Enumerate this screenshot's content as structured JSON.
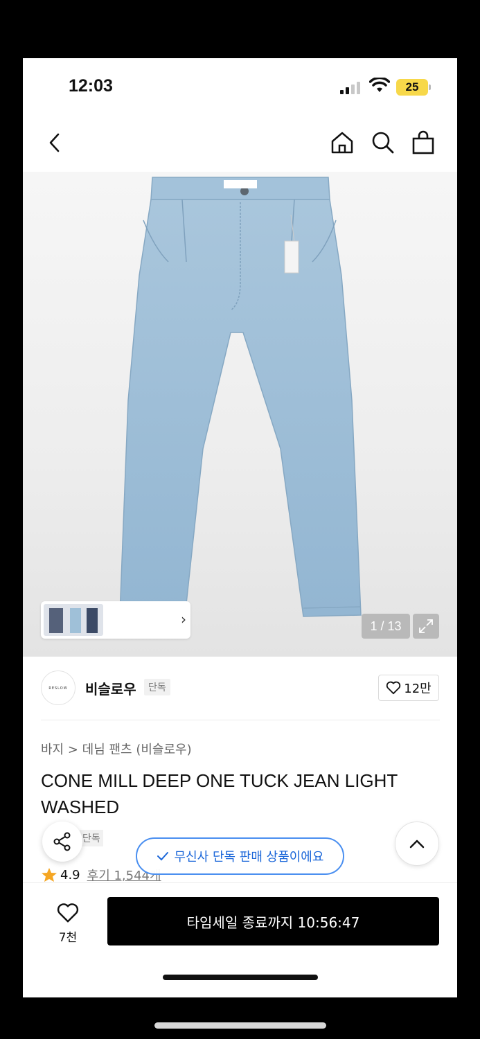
{
  "status": {
    "time": "12:03",
    "battery": "25"
  },
  "gallery": {
    "counter": "1 / 13"
  },
  "brand": {
    "logo_text": "RESLOW",
    "name": "비슬로우",
    "badge": "단독",
    "likes": "12만"
  },
  "product": {
    "breadcrumb": "바지 > 데님 팬츠 (비슬로우)",
    "title": "CONE MILL DEEP ONE TUCK JEAN LIGHT WASHED",
    "tag": "단독",
    "rating": "4.9",
    "reviews": "후기 1,544개"
  },
  "toast": "무신사 단독 판매 상품이에요",
  "bottom": {
    "wish_count": "7천",
    "buy_label": "타임세일 종료까지 10:56:47"
  },
  "colors": {
    "accent_blue": "#1a66d9",
    "star": "#f5a623",
    "denim": "#9fc0d8"
  }
}
